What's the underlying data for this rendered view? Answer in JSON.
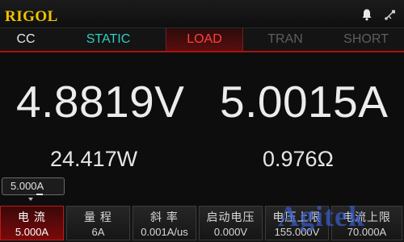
{
  "header": {
    "logo": "RIGOL",
    "icons": [
      "bell-icon",
      "usb-icon"
    ]
  },
  "tabs": [
    {
      "label": "CC",
      "color": "#e8e8e8"
    },
    {
      "label": "STATIC",
      "color": "#2ecfc4"
    },
    {
      "label": "LOAD",
      "color": "#ff4040",
      "active": true
    },
    {
      "label": "TRAN",
      "color": "#5e5e5e"
    },
    {
      "label": "SHORT",
      "color": "#5e5e5e"
    }
  ],
  "readings": {
    "voltage": "4.8819V",
    "current": "5.0015A",
    "power": "24.417W",
    "resistance": "0.976Ω"
  },
  "setpoint": {
    "value": "5.000A"
  },
  "softkeys": [
    {
      "label": "电 流",
      "value": "5.000A",
      "active": true
    },
    {
      "label": "量 程",
      "value": "6A"
    },
    {
      "label": "斜 率",
      "value": "0.001A/us"
    },
    {
      "label": "启动电压",
      "value": "0.000V"
    },
    {
      "label": "电压上限",
      "value": "155.000V"
    },
    {
      "label": "电流上限",
      "value": "70.000A"
    }
  ],
  "watermark": "Agitek",
  "colors": {
    "logo": "#f2c400",
    "accent_red": "#c01818",
    "static_cyan": "#2ecfc4"
  }
}
